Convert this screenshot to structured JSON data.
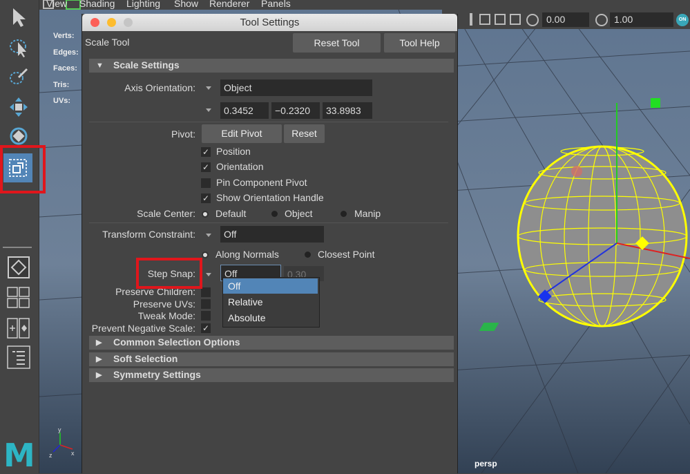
{
  "menubar": {
    "items": [
      "View",
      "Shading",
      "Lighting",
      "Show",
      "Renderer",
      "Panels"
    ]
  },
  "status_line": {
    "field_1": "0.00",
    "field_2": "1.00",
    "toggle": "ON"
  },
  "hud": {
    "verts": "Verts:",
    "edges": "Edges:",
    "faces": "Faces:",
    "tris": "Tris:",
    "uvs": "UVs:"
  },
  "viewport": {
    "camera": "persp",
    "axis_y": "y",
    "axis_x": "x",
    "axis_z": "z"
  },
  "dialog": {
    "title": "Tool Settings",
    "tool_name": "Scale Tool",
    "reset_button": "Reset Tool",
    "help_button": "Tool Help",
    "scale_settings": {
      "header": "Scale Settings",
      "axis_orientation_label": "Axis Orientation:",
      "axis_orientation_value": "Object",
      "axis_values": [
        "0.3452",
        "−0.2320",
        "33.8983"
      ],
      "pivot_label": "Pivot:",
      "edit_pivot": "Edit Pivot",
      "reset_pivot": "Reset",
      "checkboxes": [
        {
          "label": "Position",
          "checked": true
        },
        {
          "label": "Orientation",
          "checked": true
        },
        {
          "label": "Pin Component Pivot",
          "checked": false
        },
        {
          "label": "Show Orientation Handle",
          "checked": true
        }
      ],
      "scale_center_label": "Scale Center:",
      "scale_center_options": [
        "Default",
        "Object",
        "Manip"
      ],
      "transform_constraint_label": "Transform Constraint:",
      "transform_constraint_value": "Off",
      "constraint_options": [
        "Along Normals",
        "Closest Point"
      ],
      "step_snap_label": "Step Snap:",
      "step_snap_value": "Off",
      "step_snap_amount": "0.30",
      "preserve_children_label": "Preserve Children:",
      "preserve_uvs_label": "Preserve UVs:",
      "tweak_mode_label": "Tweak Mode:",
      "prevent_negative_label": "Prevent Negative Scale:"
    },
    "dropdown_options": [
      "Off",
      "Relative",
      "Absolute"
    ],
    "sections": [
      "Common Selection Options",
      "Soft Selection",
      "Symmetry Settings"
    ]
  },
  "logo": "M",
  "colors": {
    "highlight": "#e0161c",
    "selected": "#5285b7",
    "wire": "#ffff00"
  }
}
